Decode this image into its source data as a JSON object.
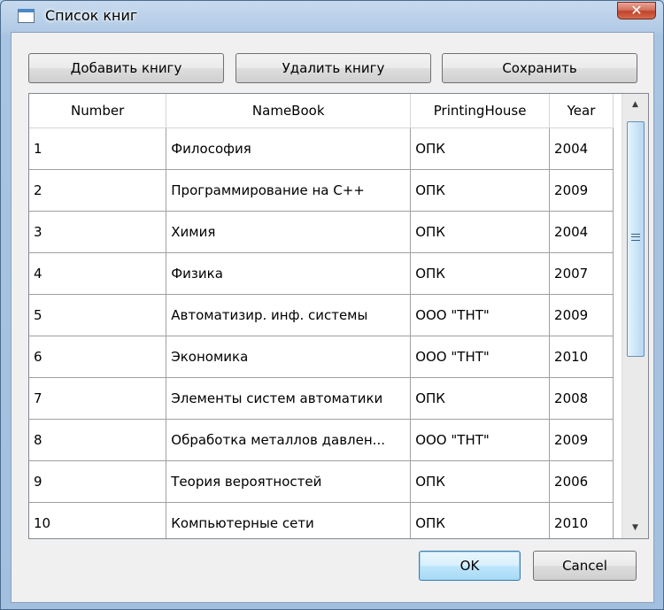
{
  "window": {
    "title": "Список книг"
  },
  "toolbar": {
    "add_label": "Добавить книгу",
    "delete_label": "Удалить книгу",
    "save_label": "Сохранить"
  },
  "grid": {
    "columns": [
      "Number",
      "NameBook",
      "PrintingHouse",
      "Year"
    ],
    "rows": [
      [
        "1",
        "Философия",
        "ОПК",
        "2004"
      ],
      [
        "2",
        "Программирование на С++",
        "ОПК",
        "2009"
      ],
      [
        "3",
        "Химия",
        "ОПК",
        "2004"
      ],
      [
        "4",
        "Физика",
        "ОПК",
        "2007"
      ],
      [
        "5",
        "Автоматизир. инф. системы",
        "ООО \"ТНТ\"",
        "2009"
      ],
      [
        "6",
        "Экономика",
        "ООО \"ТНТ\"",
        "2010"
      ],
      [
        "7",
        "Элементы систем автоматики",
        "ОПК",
        "2008"
      ],
      [
        "8",
        "Обработка металлов давлен...",
        "ООО \"ТНТ\"",
        "2009"
      ],
      [
        "9",
        "Теория вероятностей",
        "ОПК",
        "2006"
      ],
      [
        "10",
        "Компьютерные сети",
        "ОПК",
        "2010"
      ]
    ]
  },
  "footer": {
    "ok_label": "OK",
    "cancel_label": "Cancel"
  },
  "icons": {
    "window": "window-icon",
    "close": "close-icon",
    "scroll_up": "scroll-up-icon",
    "scroll_down": "scroll-down-icon"
  },
  "colors": {
    "close_button": "#c7442d",
    "default_button_border": "#3c7fb1"
  }
}
